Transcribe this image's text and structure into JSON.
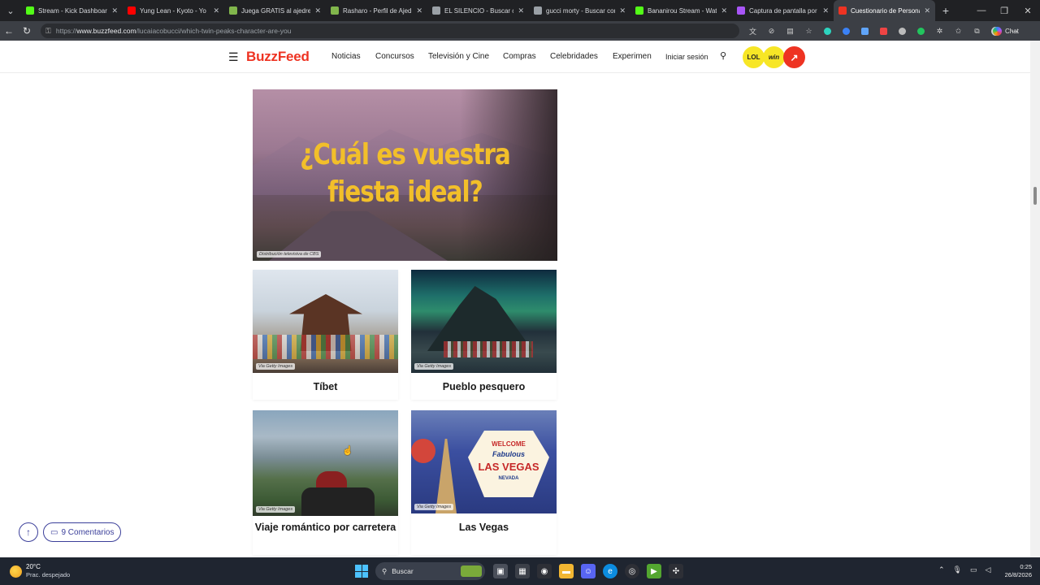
{
  "browser": {
    "tabs": [
      {
        "title": "Stream - Kick Dashboard",
        "color": "#53fc18"
      },
      {
        "title": "Yung Lean - Kyoto - Yo",
        "color": "#ff0000"
      },
      {
        "title": "Juega GRATIS al ajedrez o",
        "color": "#81b64c"
      },
      {
        "title": "Rasharo - Perfil de Ajedrez",
        "color": "#81b64c"
      },
      {
        "title": "EL SILENCIO - Buscar con",
        "color": "#9aa0a6"
      },
      {
        "title": "gucci morty - Buscar con",
        "color": "#9aa0a6"
      },
      {
        "title": "Bananirou Stream - Watch",
        "color": "#53fc18"
      },
      {
        "title": "Captura de pantalla por Li",
        "color": "#a855f7"
      },
      {
        "title": "Cuestionario de Personaje",
        "color": "#e32"
      }
    ],
    "url_prefix": "https://",
    "url_domain": "www.buzzfeed.com",
    "url_path": "/lucaiacobucci/which-twin-peaks-character-are-you",
    "chat_label": "Chat"
  },
  "site": {
    "logo": "BuzzFeed",
    "nav": [
      "Noticias",
      "Concursos",
      "Televisión y Cine",
      "Compras",
      "Celebridades",
      "Experiment"
    ],
    "login": "Iniciar sesión",
    "badges": {
      "lol": "LOL",
      "win": "win",
      "trending": "↗"
    }
  },
  "article": {
    "hero_title": "¿Cuál es vuestra fiesta ideal?",
    "hero_credit": "Distribución televisiva de CBS",
    "options": [
      {
        "label": "Tíbet",
        "credit": "Via Getty Images"
      },
      {
        "label": "Pueblo pesquero",
        "credit": "Via Getty Images"
      },
      {
        "label": "Viaje romántico por carretera",
        "credit": "Via Getty Images"
      },
      {
        "label": "Las Vegas",
        "credit": "Via Getty Images"
      }
    ],
    "vegas_sign": {
      "top": "WELCOME",
      "mid": "Fabulous",
      "main": "LAS VEGAS",
      "bottom": "NEVADA"
    }
  },
  "floating": {
    "comments": "9 Comentarios"
  },
  "taskbar": {
    "temp": "20°C",
    "weather": "Prac. despejado",
    "search": "Buscar",
    "time": "0:25",
    "date": "26/8/2026"
  }
}
